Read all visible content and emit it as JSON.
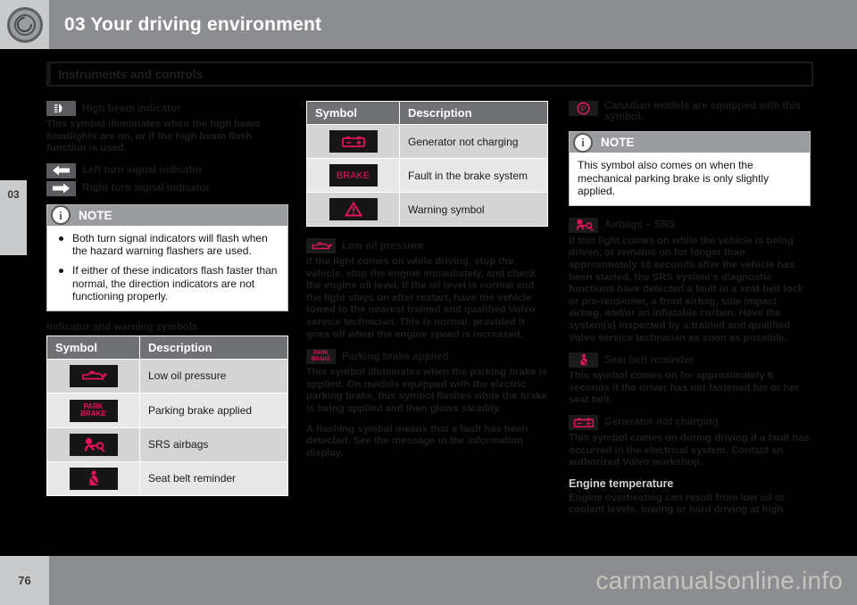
{
  "header": {
    "chapter_title": "03 Your driving environment",
    "logo_icon": "volvo-steering-wheel-icon"
  },
  "chapter_tab": {
    "number": "03"
  },
  "section": {
    "heading": "Instruments and controls"
  },
  "footer": {
    "page_number": "76",
    "watermark": "carmanualsonline.info"
  },
  "left_column": {
    "high_beam": {
      "icon": "high-beam-icon",
      "heading": "High beam indicator",
      "body": "This symbol illuminates when the high beam headlights are on, or if the high beam flash function is used."
    },
    "left_turn": {
      "icon": "left-arrow-icon",
      "heading": "Left turn signal indicator"
    },
    "right_turn": {
      "icon": "right-arrow-icon",
      "heading": "Right turn signal indicator"
    },
    "note": {
      "icon": "info-icon",
      "title": "NOTE",
      "bullets": [
        "Both turn signal indicators will flash when the hazard warning flashers are used.",
        "If either of these indicators flash faster than normal, the direction indicators are not functioning properly."
      ]
    },
    "table_heading": "Indicator and warning symbols",
    "table": {
      "columns": [
        "Symbol",
        "Description"
      ],
      "rows": [
        {
          "icon": "oil-can-icon",
          "description": "Low oil pressure"
        },
        {
          "icon": "park-brake-icon",
          "description": "Parking brake applied"
        },
        {
          "icon": "srs-airbag-icon",
          "description": "SRS airbags"
        },
        {
          "icon": "seat-belt-icon",
          "description": "Seat belt reminder"
        }
      ]
    }
  },
  "middle_column": {
    "table": {
      "columns": [
        "Symbol",
        "Description"
      ],
      "rows": [
        {
          "icon": "battery-icon",
          "description": "Generator not charging"
        },
        {
          "icon": "brake-text-icon",
          "description": "Fault in the brake system"
        },
        {
          "icon": "warning-triangle-icon",
          "description": "Warning symbol"
        }
      ]
    },
    "low_oil": {
      "icon": "oil-can-icon",
      "heading": "Low oil pressure",
      "body": "If the light comes on while driving, stop the vehicle, stop the engine immediately, and check the engine oil level. If the oil level is normal and the light stays on after restart, have the vehicle towed to the nearest trained and qualified Volvo service technician. This is normal, provided it goes off when the engine speed is increased."
    },
    "parking_brake": {
      "icon": "park-brake-icon",
      "heading": "Parking brake applied",
      "body1": "This symbol illuminates when the parking brake is applied. On models equipped with the electric parking brake, this symbol flashes while the brake is being applied and then glows steadily.",
      "body2": "A flashing symbol means that a fault has been detected. See the message in the information display."
    }
  },
  "right_column": {
    "canadian": {
      "icon": "p-circle-icon",
      "text": "Canadian models are equipped with this symbol."
    },
    "note": {
      "icon": "info-icon",
      "title": "NOTE",
      "text": "This symbol also comes on when the mechanical parking brake is only slightly applied."
    },
    "airbags": {
      "icon": "srs-airbag-icon",
      "heading": "Airbags – SRS",
      "body": "If this light comes on while the vehicle is being driven, or remains on for longer than approximately 10 seconds after the vehicle has been started, the SRS system's diagnostic functions have detected a fault in a seat belt lock or pre-tensioner, a front airbag, side impact airbag, and/or an inflatable curtain. Have the system(s) inspected by a trained and qualified Volvo service technician as soon as possible."
    },
    "seat_belt": {
      "icon": "seat-belt-icon",
      "heading": "Seat belt reminder",
      "body": "This symbol comes on for approximately 6 seconds if the driver has not fastened his or her seat belt."
    },
    "generator": {
      "icon": "battery-icon",
      "heading": "Generator not charging",
      "body": "This symbol comes on during driving if a fault has occurred in the electrical system. Contact an authorized Volvo workshop."
    },
    "engine_temp": {
      "heading": "Engine temperature",
      "body": "Engine overheating can result from low oil or coolant levels, towing or hard driving at high"
    }
  },
  "colors": {
    "header_gray": "#8b8d90",
    "tab_light": "#c9cacc",
    "icon_crimson": "#e8135b",
    "table_header": "#6f7174",
    "note_header": "#9a9c9f"
  }
}
